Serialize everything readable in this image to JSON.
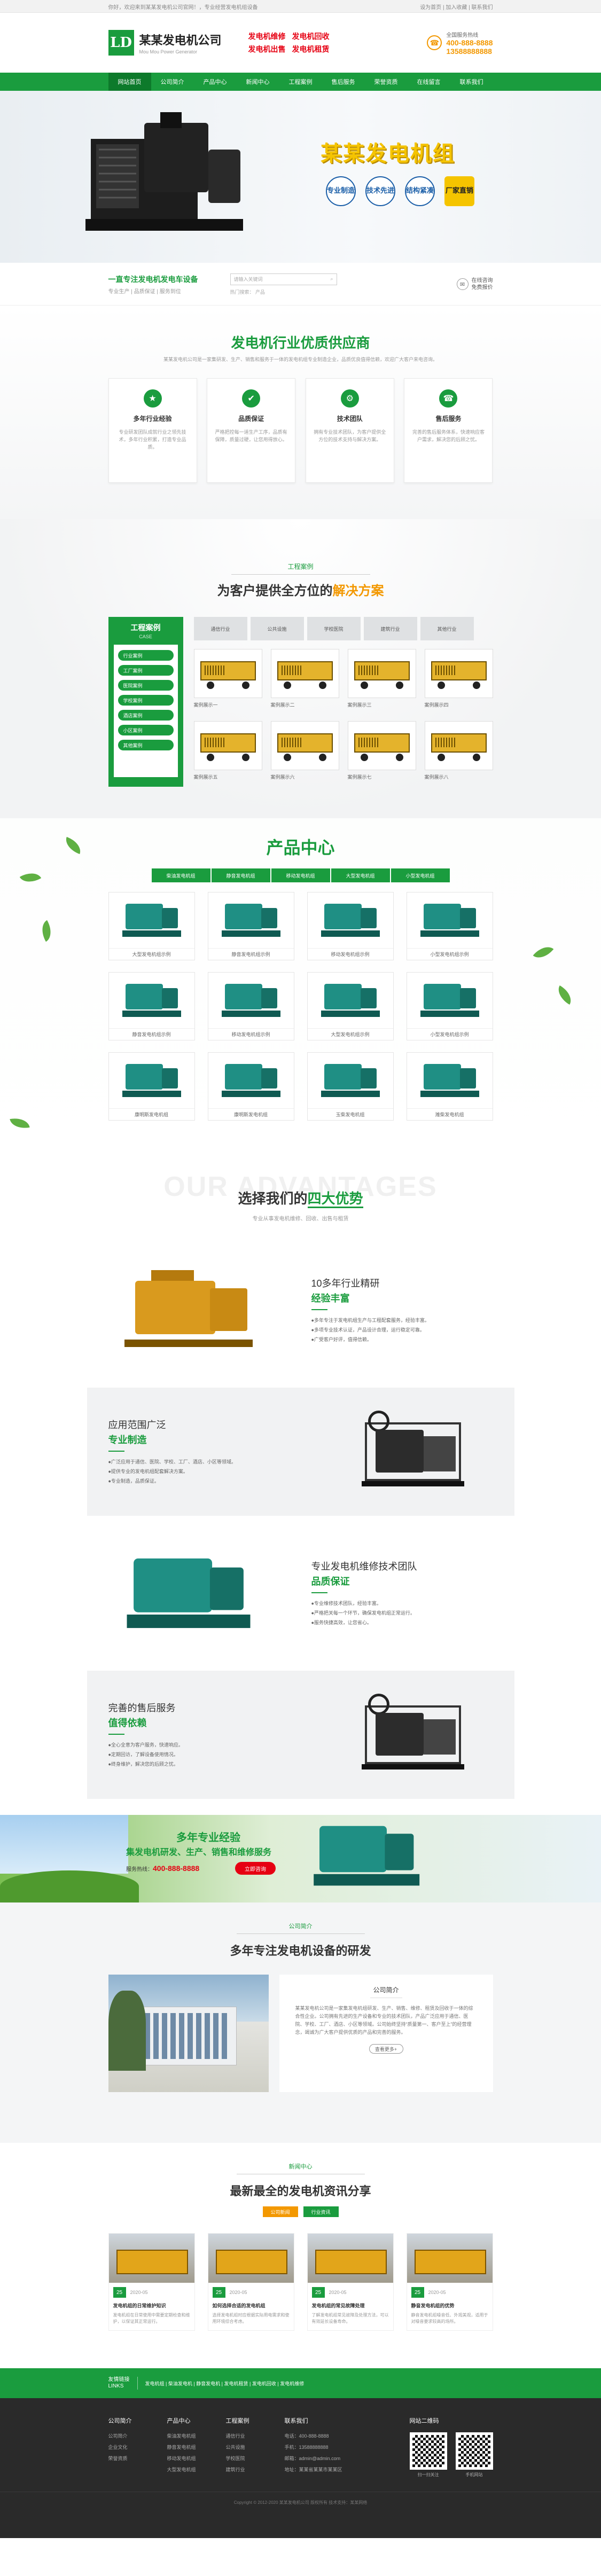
{
  "topbar": {
    "left": "你好，欢迎来到某某发电机公司官网！，专业经营发电机组设备",
    "right": "设为首页 | 加入收藏 | 联系我们"
  },
  "header": {
    "logo_mark": "LD",
    "company_name": "某某发电机公司",
    "company_en": "Mou Mou Power Generator",
    "tags": [
      "发电机维修",
      "发电机回收",
      "发电机出售",
      "发电机租赁"
    ],
    "phone_label": "全国服务热线",
    "phone_1": "400-888-8888",
    "phone_2": "13588888888"
  },
  "nav": [
    "网站首页",
    "公司简介",
    "产品中心",
    "新闻中心",
    "工程案例",
    "售后服务",
    "荣誉资质",
    "在线留言",
    "联系我们"
  ],
  "banner": {
    "title": "某某发电机组",
    "badges": [
      "专业制造",
      "技术先进",
      "结构紧凑",
      "厂家直销"
    ]
  },
  "strip": {
    "title": "一直专注发电机发电车设备",
    "subtitle": "专业生产 | 品质保证 | 服务到位",
    "search_placeholder": "请输入关键词",
    "hot": "热门搜索：  产品",
    "service_1": "在线咨询",
    "service_2": "免费报价"
  },
  "supplier": {
    "title": "发电机行业优质供应商",
    "subtitle": "某某发电机公司是一家集研发、生产、销售和服务于一体的发电机组专业制造企业，品质优良值得信赖，欢迎广大客户来电咨询。",
    "cards": [
      {
        "title": "多年行业经验",
        "desc": "专业研发团队成就行业之领先技术，多年行业积累，打造专业品质。"
      },
      {
        "title": "品质保证",
        "desc": "严格把控每一道生产工序，品质有保障，质量过硬，让您用得放心。"
      },
      {
        "title": "技术团队",
        "desc": "拥有专业技术团队，为客户提供全方位的技术支持与解决方案。"
      },
      {
        "title": "售后服务",
        "desc": "完善的售后服务体系，快速响应客户需求，解决您的后顾之忧。"
      }
    ]
  },
  "cases": {
    "en": "工程案例",
    "title_a": "为客户提供全方位的",
    "title_b": "解决方案",
    "side_title": "工程案例",
    "side_en": "CASE",
    "side_items": [
      "行业案例",
      "工厂案例",
      "医院案例",
      "学校案例",
      "酒店案例",
      "小区案例",
      "其他案例"
    ],
    "tabs": [
      "通信行业",
      "公共设施",
      "学校医院",
      "建筑行业",
      "其他行业"
    ],
    "items": [
      "案例展示一",
      "案例展示二",
      "案例展示三",
      "案例展示四",
      "案例展示五",
      "案例展示六",
      "案例展示七",
      "案例展示八"
    ]
  },
  "products": {
    "title": "产品中心",
    "tabs": [
      "柴油发电机组",
      "静音发电机组",
      "移动发电机组",
      "大型发电机组",
      "小型发电机组"
    ],
    "items": [
      "大型发电机组示例",
      "静音发电机组示例",
      "移动发电机组示例",
      "小型发电机组示例",
      "静音发电机组示例",
      "移动发电机组示例",
      "大型发电机组示例",
      "小型发电机组示例",
      "康明斯发电机组",
      "康明斯发电机组",
      "玉柴发电机组",
      "潍柴发电机组"
    ]
  },
  "advantages": {
    "en": "OUR ADVANTAGES",
    "title_a": "选择我们的",
    "title_b": "四大优势",
    "subtitle": "专业从事发电机维修、回收、出售与租赁",
    "blocks": [
      {
        "h1": "10多年行业精研",
        "h2": "经验丰富",
        "p": [
          "●多年专注于发电机组生产与工程配套服务，经验丰富。",
          "●多项专业技术认证，产品设计合理，运行稳定可靠。",
          "●广受客户好评，值得信赖。"
        ]
      },
      {
        "h1": "应用范围广泛",
        "h2": "专业制造",
        "p": [
          "●广泛应用于通信、医院、学校、工厂、酒店、小区等领域。",
          "●提供专业的发电机组配套解决方案。",
          "●专业制造，品质保证。"
        ]
      },
      {
        "h1": "专业发电机维修技术团队",
        "h2": "品质保证",
        "p": [
          "●专业维修技术团队，经验丰富。",
          "●严格把关每一个环节，确保发电机组正常运行。",
          "●服务快捷高效，让您省心。"
        ]
      },
      {
        "h1": "完善的售后服务",
        "h2": "值得依赖",
        "p": [
          "●全心全意为客户服务，快速响应。",
          "●定期回访，了解设备使用情况。",
          "●终身维护，解决您的后顾之忧。"
        ]
      }
    ]
  },
  "gbanner": {
    "t1": "多年专业经验",
    "t2": "集发电机研发、生产、销售和维修服务",
    "phone_label": "服务热线：",
    "phone": "400-888-8888",
    "button": "立即咨询"
  },
  "about": {
    "cap": "公司简介",
    "title": "多年专注发电机设备的研发",
    "box_title": "公司简介",
    "text": "某某发电机公司是一家集发电机组研发、生产、销售、维修、租赁及回收于一体的综合性企业。公司拥有先进的生产设备和专业的技术团队，产品广泛应用于通信、医院、学校、工厂、酒店、小区等领域。公司始终坚持“质量第一、客户至上”的经营理念，竭诚为广大客户提供优质的产品和完善的服务。",
    "more": "查看更多+"
  },
  "news": {
    "cap": "新闻中心",
    "title": "最新最全的发电机资讯分享",
    "tabs": [
      "公司新闻",
      "行业资讯"
    ],
    "items": [
      {
        "day": "25",
        "ym": "2020-05",
        "title": "发电机组的日常维护知识",
        "desc": "发电机组在日常使用中需要定期检查和维护，以保证其正常运行。"
      },
      {
        "day": "25",
        "ym": "2020-05",
        "title": "如何选择合适的发电机组",
        "desc": "选择发电机组时应根据实际用电需求和使用环境综合考虑。"
      },
      {
        "day": "25",
        "ym": "2020-05",
        "title": "发电机组的常见故障处理",
        "desc": "了解发电机组常见故障及处理方法，可以有效延长设备寿命。"
      },
      {
        "day": "25",
        "ym": "2020-05",
        "title": "静音发电机组的优势",
        "desc": "静音发电机组噪音低、外观美观，适用于对噪音要求较高的场所。"
      }
    ]
  },
  "links": {
    "title": "友情链接",
    "en": "LINKS",
    "text": "发电机组 | 柴油发电机 | 静音发电机 | 发电机租赁 | 发电机回收 | 发电机维修"
  },
  "footer": {
    "cols": [
      {
        "h": "公司简介",
        "items": [
          "公司简介",
          "企业文化",
          "荣誉资质"
        ]
      },
      {
        "h": "产品中心",
        "items": [
          "柴油发电机组",
          "静音发电机组",
          "移动发电机组",
          "大型发电机组"
        ]
      },
      {
        "h": "工程案例",
        "items": [
          "通信行业",
          "公共设施",
          "学校医院",
          "建筑行业"
        ]
      }
    ],
    "contact_h": "联系我们",
    "contact": [
      "电话：400-888-8888",
      "手机：13588888888",
      "邮箱：admin@admin.com",
      "地址：某某省某某市某某区"
    ],
    "qr_h": "网站二维码",
    "qr_caps": [
      "扫一扫关注",
      "手机网站"
    ],
    "copyright": "Copyright © 2012-2020 某某发电机公司 版权所有  技术支持：某某网络"
  }
}
